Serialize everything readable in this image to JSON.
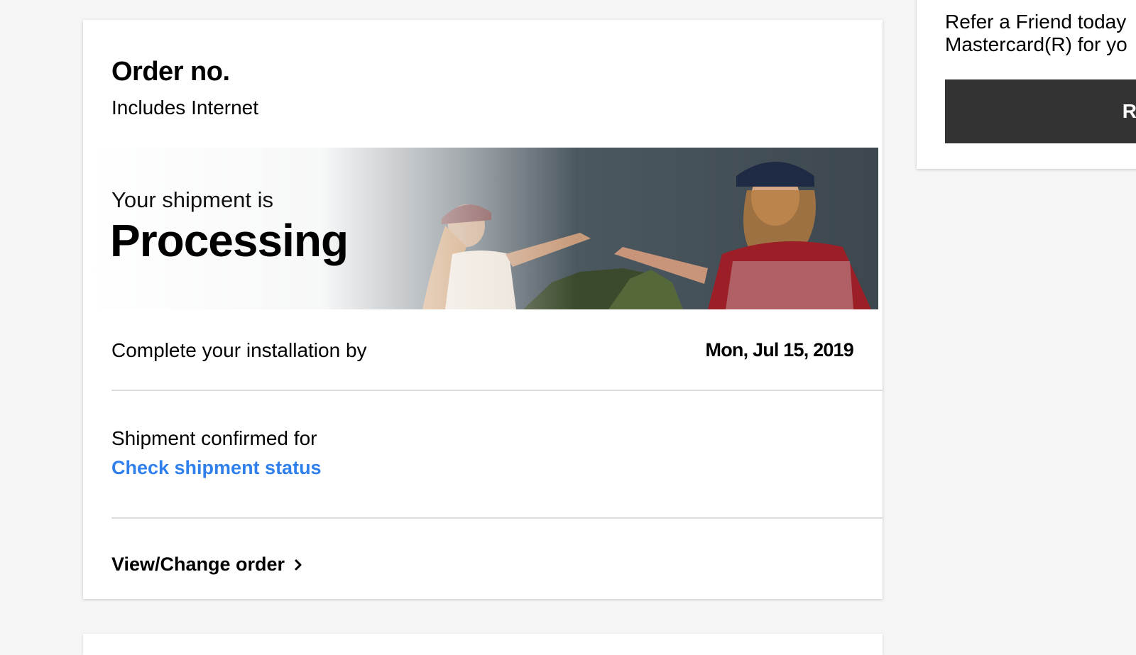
{
  "order": {
    "title": "Order no.",
    "subtitle": "Includes Internet",
    "shipment_pre": "Your shipment is",
    "shipment_status": "Processing",
    "install_label": "Complete your installation by",
    "install_date": "Mon, Jul 15, 2019",
    "shipment_confirmed": "Shipment confirmed for",
    "check_status_link": "Check shipment status",
    "view_change_order": "View/Change order"
  },
  "refer": {
    "line1": "Refer a Friend today",
    "line2": "Mastercard(R) for yo",
    "button_label": "R"
  },
  "colors": {
    "link": "#2f80ed",
    "button_bg": "#333333",
    "page_bg": "#f5f5f5"
  },
  "icons": {
    "view_change_order": "chevron-right-icon"
  }
}
